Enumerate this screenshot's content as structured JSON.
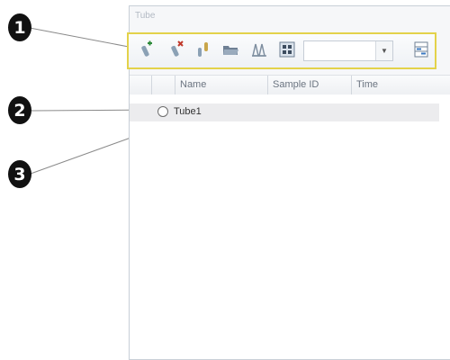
{
  "callouts": [
    "1",
    "2",
    "3"
  ],
  "panel": {
    "title": "Tube"
  },
  "toolbar": {
    "buttons": [
      {
        "icon": "add-tube-icon"
      },
      {
        "icon": "delete-tube-icon"
      },
      {
        "icon": "duplicate-tube-icon"
      },
      {
        "icon": "open-folder-icon"
      },
      {
        "icon": "tube-rack-icon"
      },
      {
        "icon": "plate-grid-icon"
      },
      {
        "icon": "column-chooser-icon"
      }
    ],
    "dropdown": {
      "value": ""
    },
    "highlight_color": "#e3d24a"
  },
  "grid": {
    "columns": [
      "",
      "",
      "Name",
      "Sample ID",
      "Time"
    ],
    "rows": [
      {
        "name": "Tube1",
        "sample_id": "",
        "time": ""
      }
    ]
  }
}
